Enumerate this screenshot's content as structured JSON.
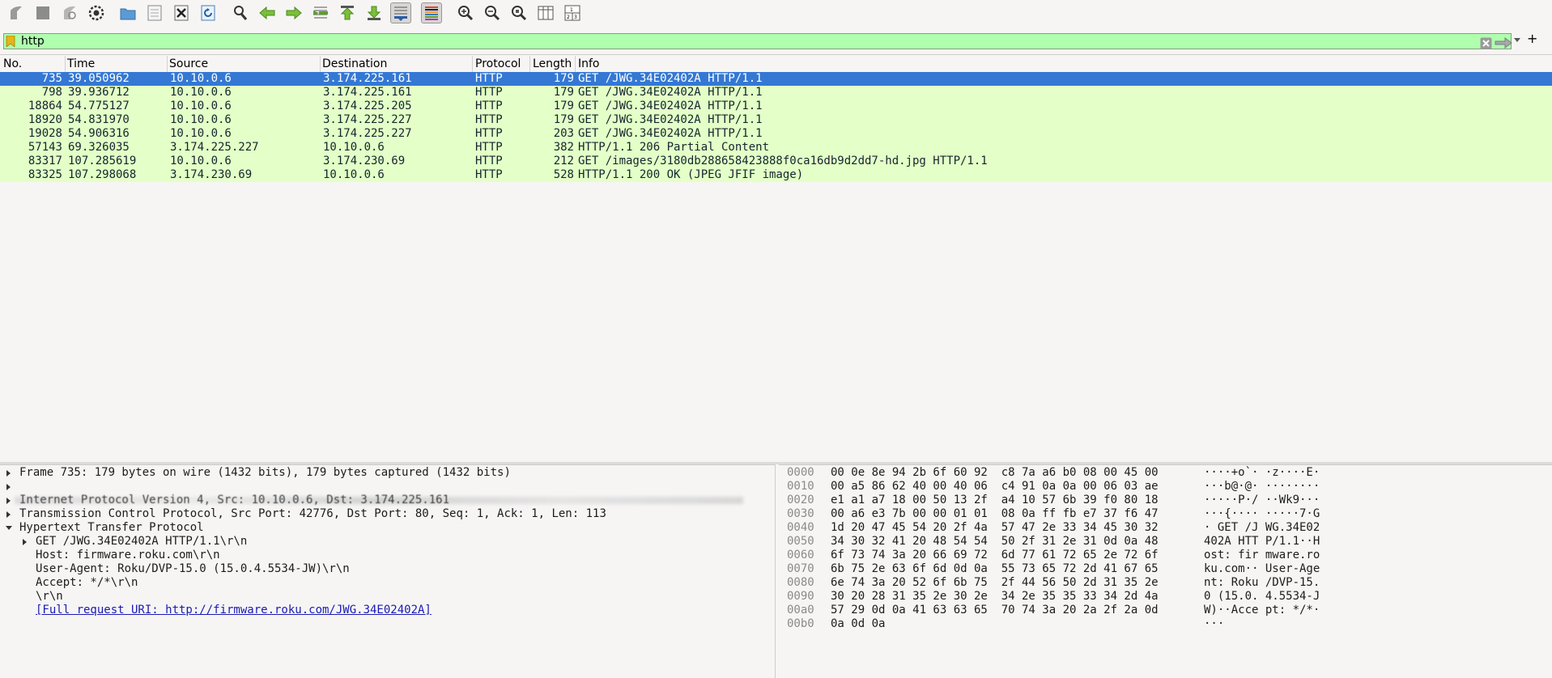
{
  "toolbar": {
    "icons": [
      "start-capture-icon",
      "stop-capture-icon",
      "restart-capture-icon",
      "capture-options-icon",
      "open-file-icon",
      "save-file-icon",
      "close-file-icon",
      "reload-file-icon",
      "find-packet-icon",
      "go-back-icon",
      "go-forward-icon",
      "go-to-packet-icon",
      "first-packet-icon",
      "last-packet-icon",
      "auto-scroll-icon",
      "colorize-icon",
      "zoom-in-icon",
      "zoom-out-icon",
      "zoom-normal-icon",
      "resize-columns-icon",
      "layout-icon"
    ]
  },
  "filter": {
    "value": "http",
    "add_label": "+"
  },
  "packet_list": {
    "columns": [
      "No.",
      "Time",
      "Source",
      "Destination",
      "Protocol",
      "Length",
      "Info"
    ],
    "rows": [
      {
        "no": "735",
        "time": "39.050962",
        "src": "10.10.0.6",
        "dst": "3.174.225.161",
        "proto": "HTTP",
        "len": "179",
        "info": "GET /JWG.34E02402A HTTP/1.1",
        "selected": true
      },
      {
        "no": "798",
        "time": "39.936712",
        "src": "10.10.0.6",
        "dst": "3.174.225.161",
        "proto": "HTTP",
        "len": "179",
        "info": "GET /JWG.34E02402A HTTP/1.1"
      },
      {
        "no": "18864",
        "time": "54.775127",
        "src": "10.10.0.6",
        "dst": "3.174.225.205",
        "proto": "HTTP",
        "len": "179",
        "info": "GET /JWG.34E02402A HTTP/1.1"
      },
      {
        "no": "18920",
        "time": "54.831970",
        "src": "10.10.0.6",
        "dst": "3.174.225.227",
        "proto": "HTTP",
        "len": "179",
        "info": "GET /JWG.34E02402A HTTP/1.1"
      },
      {
        "no": "19028",
        "time": "54.906316",
        "src": "10.10.0.6",
        "dst": "3.174.225.227",
        "proto": "HTTP",
        "len": "203",
        "info": "GET /JWG.34E02402A HTTP/1.1"
      },
      {
        "no": "57143",
        "time": "69.326035",
        "src": "3.174.225.227",
        "dst": "10.10.0.6",
        "proto": "HTTP",
        "len": "382",
        "info": "HTTP/1.1 206 Partial Content"
      },
      {
        "no": "83317",
        "time": "107.285619",
        "src": "10.10.0.6",
        "dst": "3.174.230.69",
        "proto": "HTTP",
        "len": "212",
        "info": "GET /images/3180db288658423888f0ca16db9d2dd7-hd.jpg HTTP/1.1"
      },
      {
        "no": "83325",
        "time": "107.298068",
        "src": "3.174.230.69",
        "dst": "10.10.0.6",
        "proto": "HTTP",
        "len": "528",
        "info": "HTTP/1.1 200 OK  (JPEG JFIF image)"
      }
    ]
  },
  "details": {
    "frame": "Frame 735: 179 bytes on wire (1432 bits), 179 bytes captured (1432 bits)",
    "ip": "Internet Protocol Version 4, Src: 10.10.0.6, Dst: 3.174.225.161",
    "tcp": "Transmission Control Protocol, Src Port: 42776, Dst Port: 80, Seq: 1, Ack: 1, Len: 113",
    "http": "Hypertext Transfer Protocol",
    "http_get": "GET /JWG.34E02402A HTTP/1.1\\r\\n",
    "host": "Host: firmware.roku.com\\r\\n",
    "user_agent": "User-Agent: Roku/DVP-15.0 (15.0.4.5534-JW)\\r\\n",
    "accept": "Accept: */*\\r\\n",
    "crlf": "\\r\\n",
    "full_uri": "[Full request URI: http://firmware.roku.com/JWG.34E02402A]"
  },
  "bytes": {
    "rows": [
      {
        "off": "0000",
        "hex": "00 0e 8e 94 2b 6f 60 92  c8 7a a6 b0 08 00 45 00",
        "ascii": "····+o`· ·z····E·"
      },
      {
        "off": "0010",
        "hex": "00 a5 86 62 40 00 40 06  c4 91 0a 0a 00 06 03 ae",
        "ascii": "···b@·@· ········"
      },
      {
        "off": "0020",
        "hex": "e1 a1 a7 18 00 50 13 2f  a4 10 57 6b 39 f0 80 18",
        "ascii": "·····P·/ ··Wk9···"
      },
      {
        "off": "0030",
        "hex": "00 a6 e3 7b 00 00 01 01  08 0a ff fb e7 37 f6 47",
        "ascii": "···{···· ·····7·G"
      },
      {
        "off": "0040",
        "hex": "1d 20 47 45 54 20 2f 4a  57 47 2e 33 34 45 30 32",
        "ascii": "· GET /J WG.34E02"
      },
      {
        "off": "0050",
        "hex": "34 30 32 41 20 48 54 54  50 2f 31 2e 31 0d 0a 48",
        "ascii": "402A HTT P/1.1··H"
      },
      {
        "off": "0060",
        "hex": "6f 73 74 3a 20 66 69 72  6d 77 61 72 65 2e 72 6f",
        "ascii": "ost: fir mware.ro"
      },
      {
        "off": "0070",
        "hex": "6b 75 2e 63 6f 6d 0d 0a  55 73 65 72 2d 41 67 65",
        "ascii": "ku.com·· User-Age"
      },
      {
        "off": "0080",
        "hex": "6e 74 3a 20 52 6f 6b 75  2f 44 56 50 2d 31 35 2e",
        "ascii": "nt: Roku /DVP-15."
      },
      {
        "off": "0090",
        "hex": "30 20 28 31 35 2e 30 2e  34 2e 35 35 33 34 2d 4a",
        "ascii": "0 (15.0. 4.5534-J"
      },
      {
        "off": "00a0",
        "hex": "57 29 0d 0a 41 63 63 65  70 74 3a 20 2a 2f 2a 0d",
        "ascii": "W)··Acce pt: */*·"
      },
      {
        "off": "00b0",
        "hex": "0a 0d 0a",
        "ascii": "···"
      }
    ]
  },
  "colors": {
    "filter_bg": "#afffaf",
    "row_bg": "#e4ffc7",
    "selected_bg": "#3478d4"
  }
}
